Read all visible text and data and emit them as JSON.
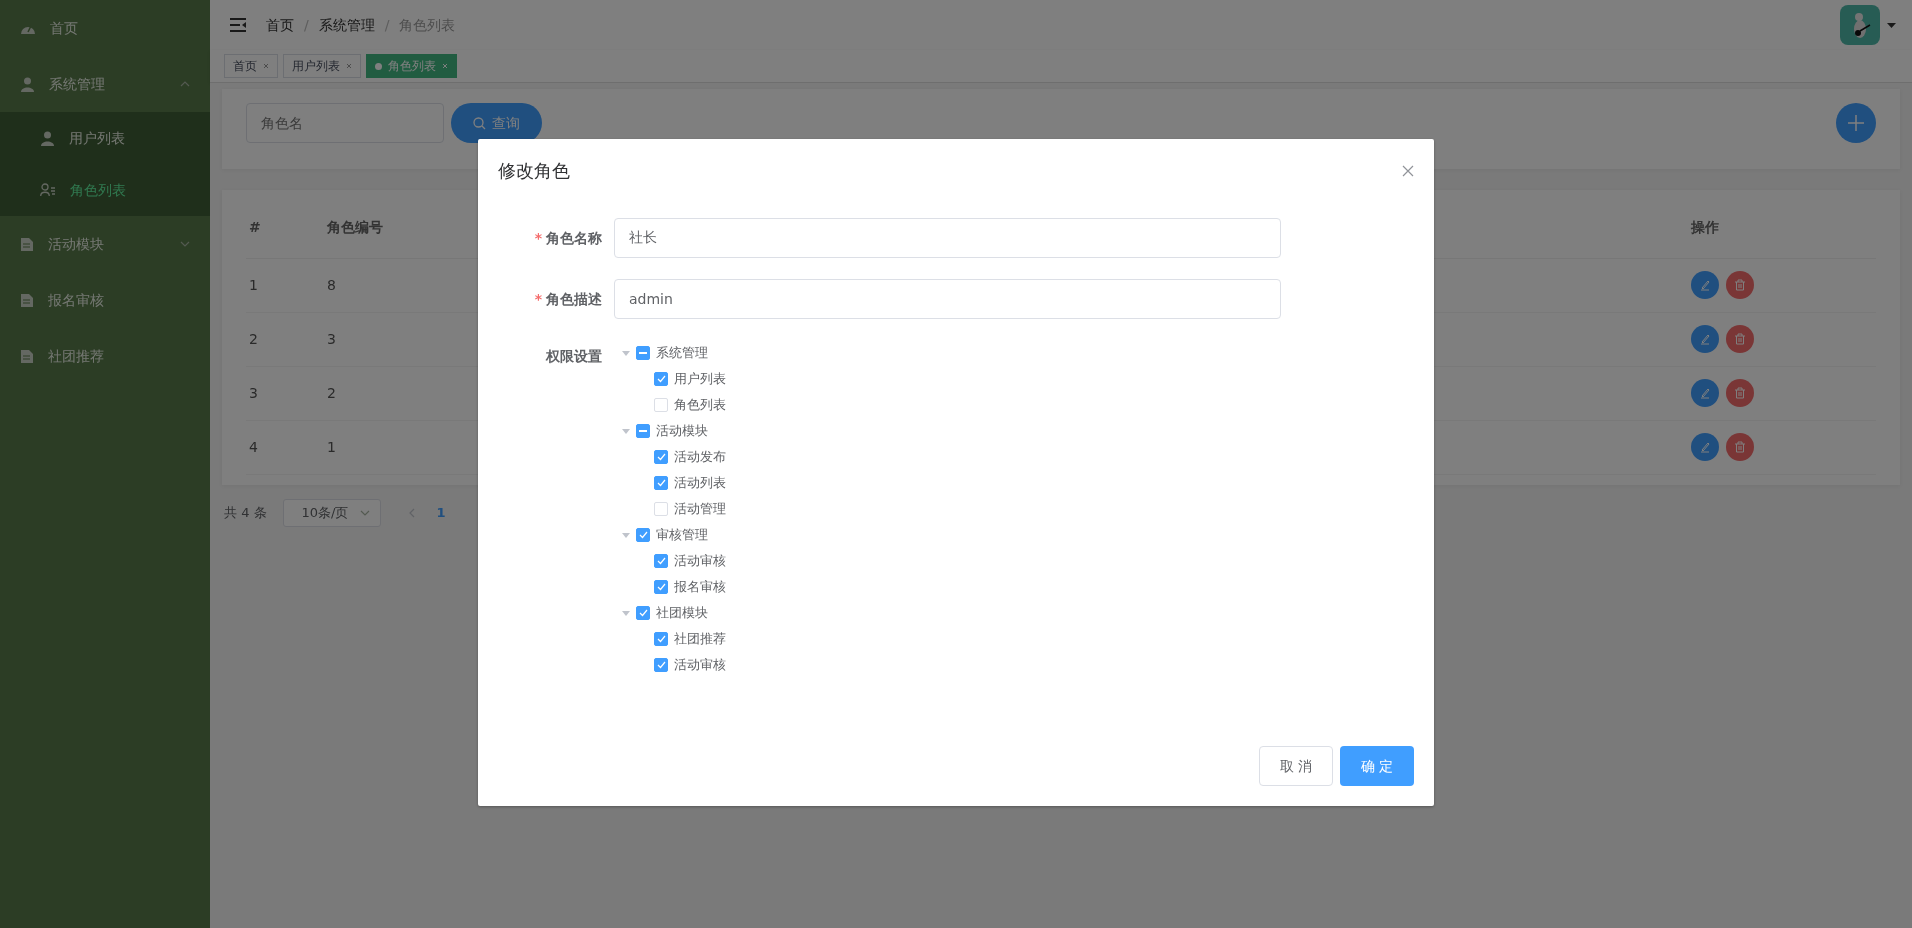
{
  "sidebar": {
    "items": [
      {
        "label": "首页",
        "kind": "dashboard"
      },
      {
        "label": "系统管理",
        "kind": "person",
        "expanded": true,
        "children": [
          {
            "label": "用户列表",
            "kind": "person",
            "selected": false
          },
          {
            "label": "角色列表",
            "kind": "people",
            "selected": true
          }
        ]
      },
      {
        "label": "活动模块",
        "kind": "document",
        "expanded": false
      },
      {
        "label": "报名审核",
        "kind": "document"
      },
      {
        "label": "社团推荐",
        "kind": "document"
      }
    ]
  },
  "header": {
    "breadcrumb": [
      "首页",
      "系统管理",
      "角色列表"
    ],
    "separator": "/"
  },
  "tabs": [
    {
      "label": "首页",
      "selected": false
    },
    {
      "label": "用户列表",
      "selected": false
    },
    {
      "label": "角色列表",
      "selected": true
    }
  ],
  "search": {
    "placeholder": "角色名",
    "button": "查询"
  },
  "table": {
    "columns": [
      "#",
      "角色编号",
      "操作"
    ],
    "rows": [
      {
        "index": "1",
        "code": "8"
      },
      {
        "index": "2",
        "code": "3"
      },
      {
        "index": "3",
        "code": "2"
      },
      {
        "index": "4",
        "code": "1"
      }
    ]
  },
  "pagination": {
    "total": "共 4 条",
    "page_size": "10条/页",
    "pages": [
      {
        "label": "1",
        "selected": true
      }
    ]
  },
  "dialog": {
    "title": "修改角色",
    "fields": [
      {
        "label": "角色名称",
        "required_mark": "*",
        "value": "社长"
      },
      {
        "label": "角色描述",
        "required_mark": "*",
        "value": "admin"
      }
    ],
    "permissions_label": "权限设置",
    "tree": [
      {
        "label": "系统管理",
        "indeterminate": true,
        "expanded": true,
        "children": [
          {
            "label": "用户列表",
            "checked": true
          },
          {
            "label": "角色列表",
            "checked": false
          }
        ]
      },
      {
        "label": "活动模块",
        "indeterminate": true,
        "expanded": true,
        "children": [
          {
            "label": "活动发布",
            "checked": true
          },
          {
            "label": "活动列表",
            "checked": true
          },
          {
            "label": "活动管理",
            "checked": false
          }
        ]
      },
      {
        "label": "审核管理",
        "checked": true,
        "indeterminate": false,
        "expanded": true,
        "children": [
          {
            "label": "活动审核",
            "checked": true
          },
          {
            "label": "报名审核",
            "checked": true
          }
        ]
      },
      {
        "label": "社团模块",
        "checked": true,
        "indeterminate": false,
        "expanded": true,
        "children": [
          {
            "label": "社团推荐",
            "checked": true
          },
          {
            "label": "活动审核",
            "checked": true
          }
        ]
      }
    ],
    "buttons": [
      {
        "label": "取 消",
        "kind": "cancel"
      },
      {
        "label": "确 定",
        "kind": "confirm"
      }
    ]
  }
}
